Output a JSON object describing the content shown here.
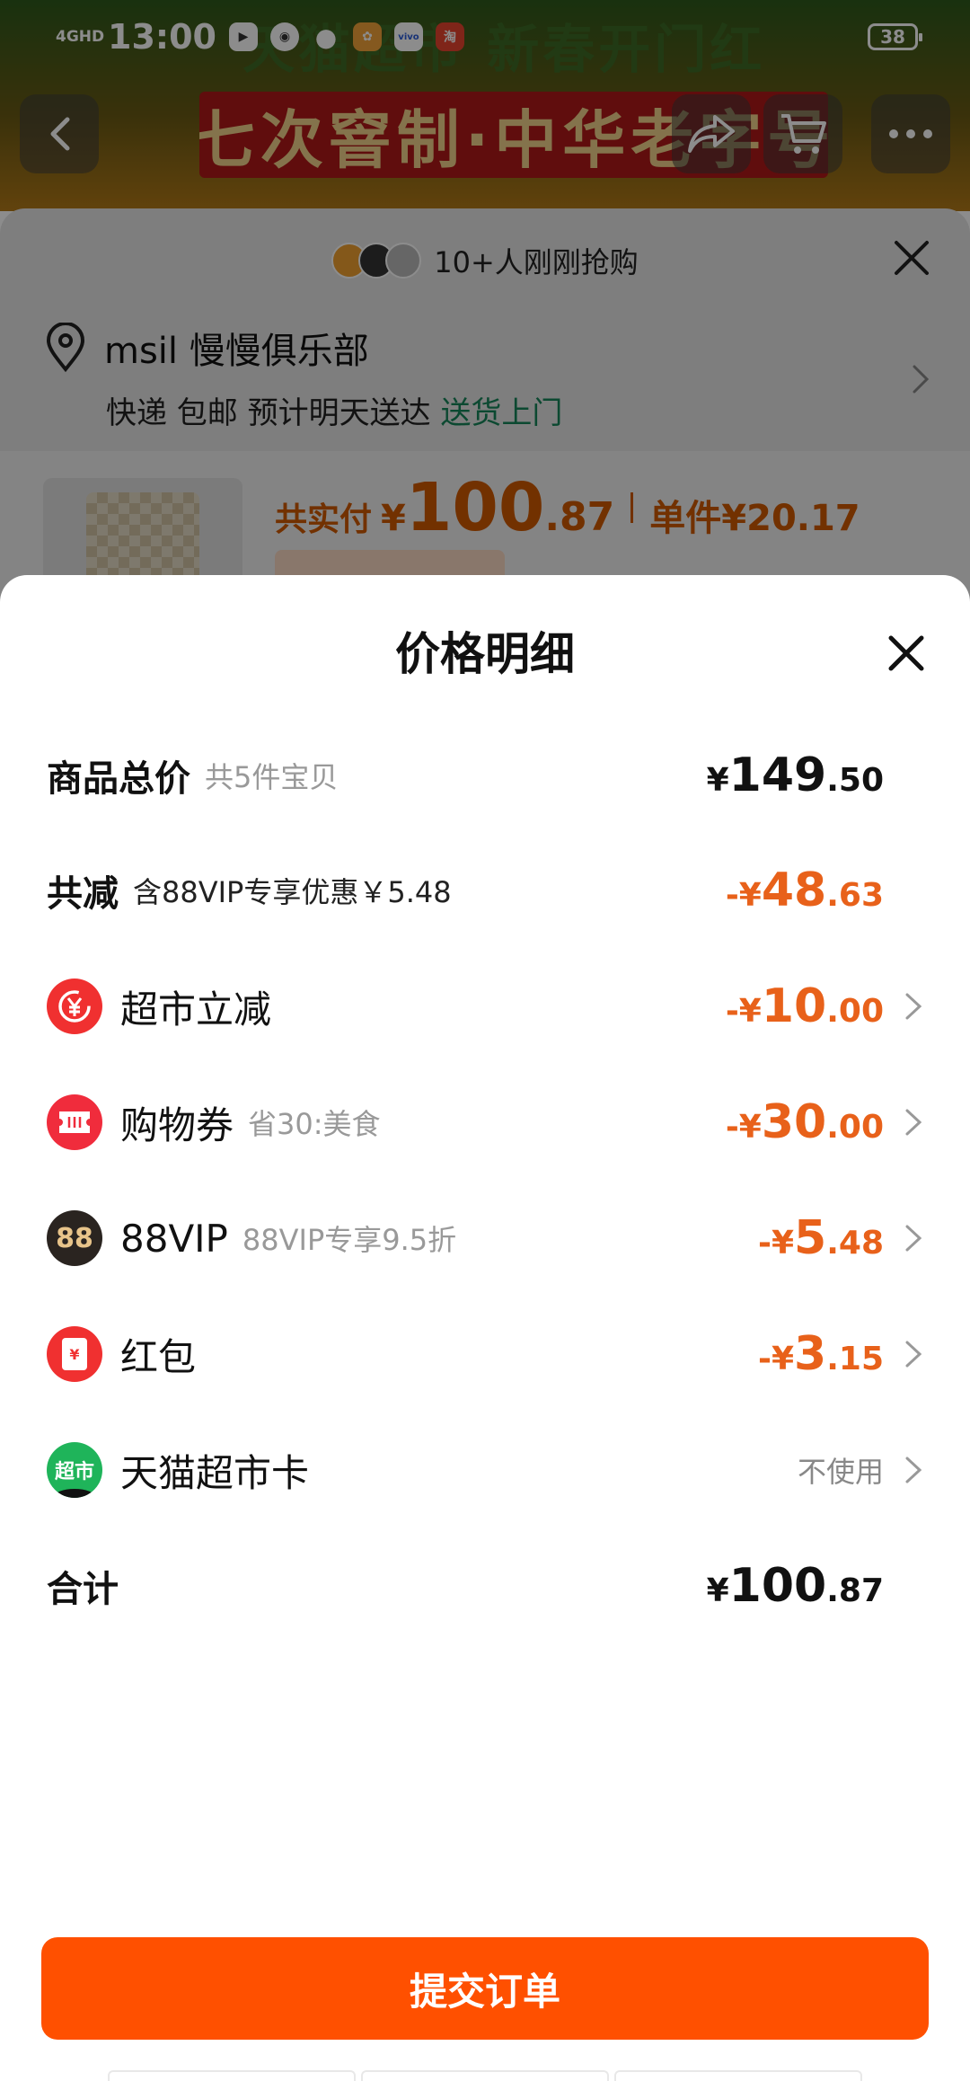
{
  "status_bar": {
    "network": "4GHD",
    "time": "13:00",
    "battery": "38"
  },
  "background_page": {
    "headline": "天猫超市 新春开门红",
    "banner": "七次窨制·中华老字号"
  },
  "order_sheet": {
    "buyers_text": "10+人刚刚抢购",
    "address_name": "msil 慢慢俱乐部",
    "shipping_text": "快递 包邮 预计明天送达",
    "shipping_highlight": "送货上门",
    "pay_label": "共实付",
    "pay_yen": "¥",
    "pay_int": "100",
    "pay_dec": ".87",
    "unit_price": "单件¥20.17"
  },
  "price_detail": {
    "title": "价格明细",
    "total_goods": {
      "label": "商品总价",
      "sub": "共5件宝贝",
      "sign": "¥",
      "int": "149",
      "dec": ".50"
    },
    "total_discount": {
      "label": "共减",
      "sub": "含88VIP专享优惠￥5.48",
      "sign": "-¥",
      "int": "48",
      "dec": ".63"
    },
    "items": [
      {
        "label": "超市立减",
        "sub": "",
        "sign": "-¥",
        "int": "10",
        "dec": ".00",
        "icon": "yen-rebate-icon"
      },
      {
        "label": "购物券",
        "sub": "省30:美食",
        "sign": "-¥",
        "int": "30",
        "dec": ".00",
        "icon": "coupon-icon"
      },
      {
        "label": "88VIP",
        "sub": "88VIP专享9.5折",
        "sign": "-¥",
        "int": "5",
        "dec": ".48",
        "icon": "88vip-icon"
      },
      {
        "label": "红包",
        "sub": "",
        "sign": "-¥",
        "int": "3",
        "dec": ".15",
        "icon": "red-packet-icon"
      }
    ],
    "supermarket_card": {
      "label": "天猫超市卡",
      "status": "不使用",
      "icon_text": "超市"
    },
    "grand_total": {
      "label": "合计",
      "sign": "¥",
      "int": "100",
      "dec": ".87"
    },
    "icon_88_text": "88",
    "coupon_icon_text": "¥"
  },
  "submit_button": "提交订单",
  "colors": {
    "accent_orange": "#ff5000",
    "discount_orange": "#e8611a",
    "ship_green": "#17855a",
    "icon_red": "#f03030",
    "icon_dark": "#2a2420",
    "icon_green": "#1fb45a"
  }
}
